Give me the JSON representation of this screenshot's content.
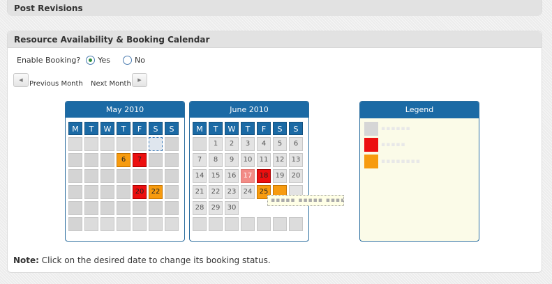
{
  "post_revisions": {
    "title": "Post Revisions"
  },
  "booking_panel": {
    "title": "Resource Availability & Booking Calendar",
    "enable_label": "Enable Booking?",
    "options": [
      {
        "label": "Yes",
        "selected": true
      },
      {
        "label": "No",
        "selected": false
      }
    ],
    "prev_label": "Previous Month",
    "next_label": "Next Month",
    "note_label": "Note:",
    "note_text": "Click on the desired date to change its booking status."
  },
  "calendars": [
    {
      "title": "May 2010",
      "weekdays": [
        "M",
        "T",
        "W",
        "T",
        "F",
        "S",
        "S"
      ],
      "cells": [
        {
          "t": "",
          "s": "other"
        },
        {
          "t": "",
          "s": "other"
        },
        {
          "t": "",
          "s": "other"
        },
        {
          "t": "",
          "s": "other"
        },
        {
          "t": "",
          "s": "other"
        },
        {
          "t": "",
          "s": "sel"
        },
        {
          "t": "",
          "s": "plain"
        },
        {
          "t": "",
          "s": "plain"
        },
        {
          "t": "",
          "s": "plain"
        },
        {
          "t": "",
          "s": "plain"
        },
        {
          "t": "6",
          "s": "orange"
        },
        {
          "t": "7",
          "s": "red"
        },
        {
          "t": "",
          "s": "plain"
        },
        {
          "t": "",
          "s": "plain"
        },
        {
          "t": "",
          "s": "plain"
        },
        {
          "t": "",
          "s": "plain"
        },
        {
          "t": "",
          "s": "plain"
        },
        {
          "t": "",
          "s": "plain"
        },
        {
          "t": "",
          "s": "plain"
        },
        {
          "t": "",
          "s": "plain"
        },
        {
          "t": "",
          "s": "plain"
        },
        {
          "t": "",
          "s": "plain"
        },
        {
          "t": "",
          "s": "plain"
        },
        {
          "t": "",
          "s": "plain"
        },
        {
          "t": "",
          "s": "plain"
        },
        {
          "t": "20",
          "s": "red"
        },
        {
          "t": "22",
          "s": "orange"
        },
        {
          "t": "",
          "s": "plain"
        },
        {
          "t": "",
          "s": "plain"
        },
        {
          "t": "",
          "s": "plain"
        },
        {
          "t": "",
          "s": "plain"
        },
        {
          "t": "",
          "s": "plain"
        },
        {
          "t": "",
          "s": "plain"
        },
        {
          "t": "",
          "s": "plain"
        },
        {
          "t": "",
          "s": "plain"
        },
        {
          "t": "",
          "s": "plain"
        },
        {
          "t": "",
          "s": "other"
        },
        {
          "t": "",
          "s": "other"
        },
        {
          "t": "",
          "s": "other"
        },
        {
          "t": "",
          "s": "other"
        },
        {
          "t": "",
          "s": "other"
        },
        {
          "t": "",
          "s": "other"
        }
      ]
    },
    {
      "title": "June 2010",
      "weekdays": [
        "M",
        "T",
        "W",
        "T",
        "F",
        "S",
        "S"
      ],
      "cells": [
        {
          "t": "",
          "s": "other"
        },
        {
          "t": "1",
          "s": "num"
        },
        {
          "t": "2",
          "s": "num"
        },
        {
          "t": "3",
          "s": "num"
        },
        {
          "t": "4",
          "s": "num"
        },
        {
          "t": "5",
          "s": "num"
        },
        {
          "t": "6",
          "s": "num"
        },
        {
          "t": "7",
          "s": "num"
        },
        {
          "t": "8",
          "s": "num"
        },
        {
          "t": "9",
          "s": "num"
        },
        {
          "t": "10",
          "s": "num"
        },
        {
          "t": "11",
          "s": "num"
        },
        {
          "t": "12",
          "s": "num"
        },
        {
          "t": "13",
          "s": "num"
        },
        {
          "t": "14",
          "s": "num"
        },
        {
          "t": "15",
          "s": "num"
        },
        {
          "t": "16",
          "s": "num"
        },
        {
          "t": "17",
          "s": "pink"
        },
        {
          "t": "18",
          "s": "red"
        },
        {
          "t": "19",
          "s": "num"
        },
        {
          "t": "20",
          "s": "num"
        },
        {
          "t": "21",
          "s": "num"
        },
        {
          "t": "22",
          "s": "num"
        },
        {
          "t": "23",
          "s": "num"
        },
        {
          "t": "24",
          "s": "num"
        },
        {
          "t": "25",
          "s": "orange"
        },
        {
          "t": "",
          "s": "orange"
        },
        {
          "t": "",
          "s": "num"
        },
        {
          "t": "28",
          "s": "num"
        },
        {
          "t": "29",
          "s": "num"
        },
        {
          "t": "30",
          "s": "num"
        },
        {
          "t": "",
          "s": "empty"
        },
        {
          "t": "",
          "s": "empty"
        },
        {
          "t": "",
          "s": "empty"
        },
        {
          "t": "",
          "s": "empty"
        },
        {
          "t": "",
          "s": "other"
        },
        {
          "t": "",
          "s": "other"
        },
        {
          "t": "",
          "s": "other"
        },
        {
          "t": "",
          "s": "other"
        },
        {
          "t": "",
          "s": "other"
        },
        {
          "t": "",
          "s": "other"
        },
        {
          "t": "",
          "s": "other"
        }
      ]
    }
  ],
  "legend": {
    "title": "Legend",
    "items": [
      {
        "color": "#d6d6d6"
      },
      {
        "color": "#ec0f0f"
      },
      {
        "color": "#f79b0f"
      }
    ]
  },
  "colors": {
    "header_blue": "#1b6aa5",
    "booked_red": "#ec0f0f",
    "partial_orange": "#f79b0f",
    "pending_pink": "#f28b86"
  }
}
